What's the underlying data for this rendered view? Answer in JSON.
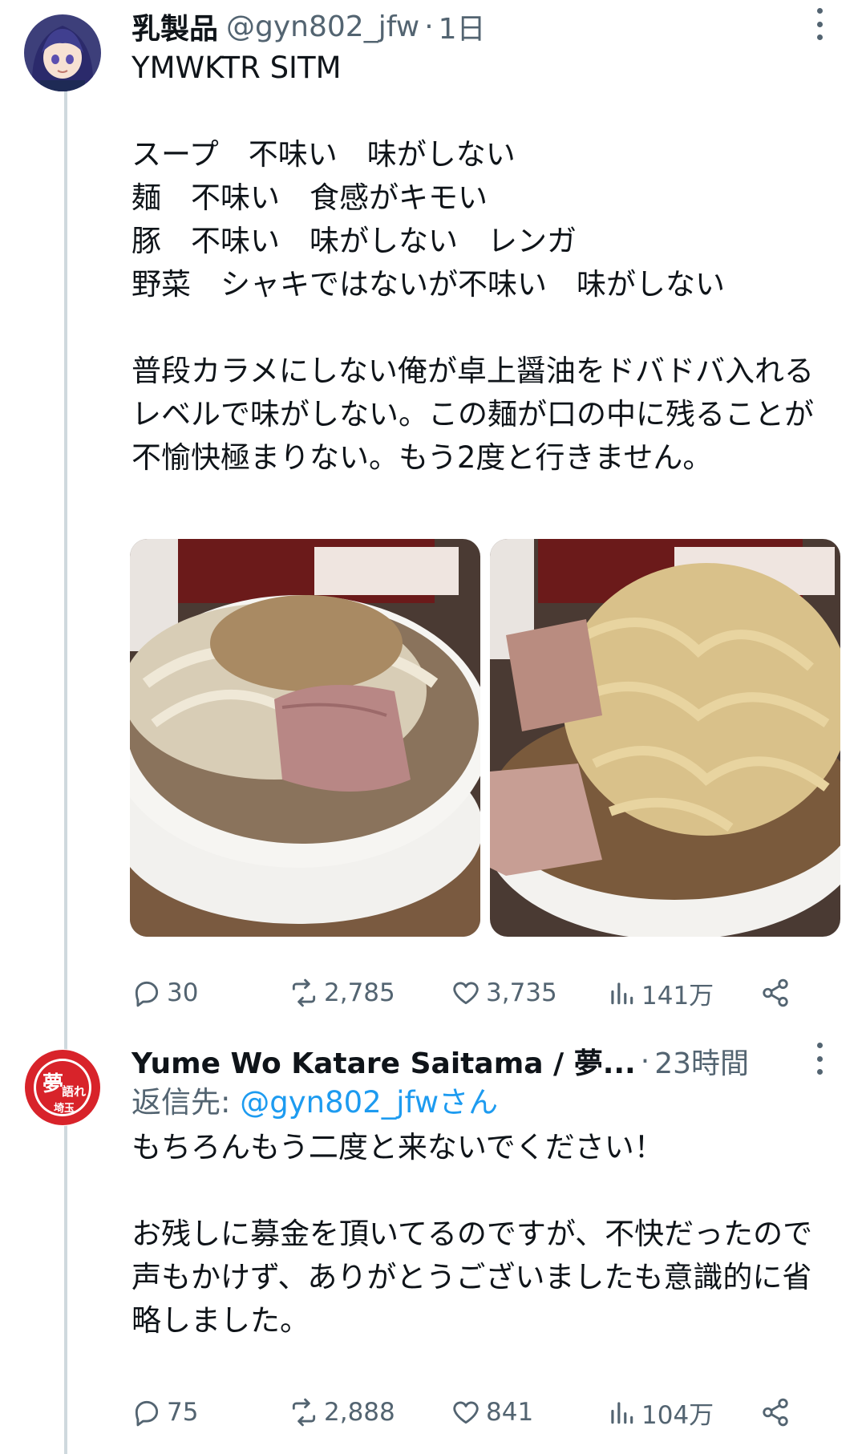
{
  "tweet1": {
    "display_name": "乳製品",
    "handle": "@gyn802_jfw",
    "separator": "·",
    "time": "1日",
    "text": "YMWKTR SITM\n\nスープ　不味い　味がしない\n麺　不味い　食感がキモい\n豚　不味い　味がしない　レンガ\n野菜　シャキではないが不味い　味がしない\n\n普段カラメにしない俺が卓上醤油をドバドバ入れるレベルで味がしない。この麺が口の中に残ることが不愉快極まりない。もう2度と行きません。",
    "stats": {
      "replies": "30",
      "retweets": "2,785",
      "likes": "3,735",
      "views": "141万"
    }
  },
  "tweet2": {
    "display_name": "Yume Wo Katare Saitama / 夢...",
    "separator": "·",
    "time": "23時間",
    "reply_prefix": "返信先: ",
    "reply_handle": "@gyn802_jfwさん",
    "text": "もちろんもう二度と来ないでください！\n\nお残しに募金を頂いてるのですが、不快だったので声もかけず、ありがとうございましたも意識的に省略しました。",
    "avatar_logo": "夢を語れ 埼玉",
    "stats": {
      "replies": "75",
      "retweets": "2,888",
      "likes": "841",
      "views": "104万"
    }
  },
  "colors": {
    "accent": "#1d9bf0",
    "muted": "#536471",
    "text": "#0f1419",
    "logo_red": "#d8232a"
  },
  "icons": [
    "more-icon",
    "reply-icon",
    "retweet-icon",
    "like-icon",
    "views-icon",
    "share-icon"
  ]
}
